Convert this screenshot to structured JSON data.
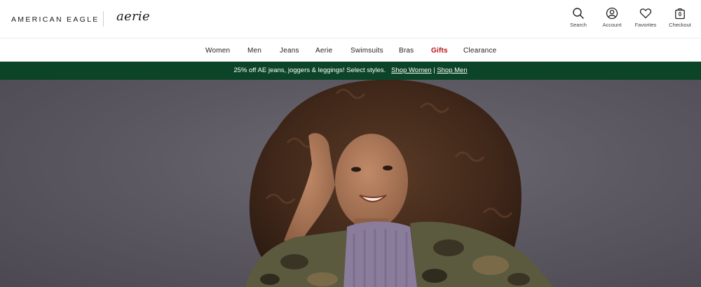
{
  "header": {
    "brand_primary": "AMERICAN EAGLE",
    "brand_secondary": "aerie",
    "utility": [
      {
        "label": "Search",
        "icon": "search-icon"
      },
      {
        "label": "Account",
        "icon": "account-icon"
      },
      {
        "label": "Favorites",
        "icon": "heart-icon"
      },
      {
        "label": "Checkout",
        "icon": "bag-icon",
        "count": "0"
      }
    ]
  },
  "nav": {
    "items": [
      {
        "label": "Women"
      },
      {
        "label": "Men"
      },
      {
        "label": "Jeans"
      },
      {
        "label": "Aerie"
      },
      {
        "label": "Swimsuits"
      },
      {
        "label": "Bras"
      },
      {
        "label": "Gifts",
        "highlight_color": "#b5121b"
      },
      {
        "label": "Clearance"
      }
    ]
  },
  "promo": {
    "text": "25% off AE jeans, joggers & leggings! Select styles.",
    "link_women": "Shop Women",
    "separator": "|",
    "link_men": "Shop Men",
    "background": "#0c4427"
  },
  "colors": {
    "brand_green": "#0c4427",
    "gifts_red": "#b5121b"
  }
}
